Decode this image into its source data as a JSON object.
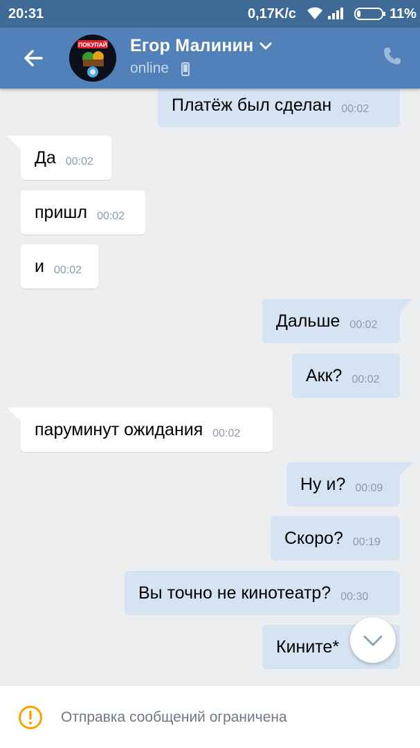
{
  "status_bar": {
    "time": "20:31",
    "speed": "0,17K/c",
    "battery": "11%"
  },
  "header": {
    "name": "Егор Малинин",
    "status": "online",
    "avatar_label": "ПОКУПАЙ"
  },
  "messages": [
    {
      "text": "Платёж был сделан",
      "time": "00:02",
      "dir": "out"
    },
    {
      "text": "Да",
      "time": "00:02",
      "dir": "in"
    },
    {
      "text": "пришл",
      "time": "00:02",
      "dir": "in"
    },
    {
      "text": "и",
      "time": "00:02",
      "dir": "in"
    },
    {
      "text": "Дальше",
      "time": "00:02",
      "dir": "out"
    },
    {
      "text": "Акк?",
      "time": "00:02",
      "dir": "out"
    },
    {
      "text": "паруминут ожидания",
      "time": "00:02",
      "dir": "in"
    },
    {
      "text": "Ну и?",
      "time": "00:09",
      "dir": "out"
    },
    {
      "text": "Скоро?",
      "time": "00:19",
      "dir": "out"
    },
    {
      "text": "Вы точно не кинотеатр?",
      "time": "00:30",
      "dir": "out"
    },
    {
      "text": "Кините*",
      "time": "",
      "dir": "out"
    }
  ],
  "bottom_bar": {
    "notice": "Отправка сообщений ограничена",
    "icon": "warning-icon"
  },
  "colors": {
    "header": "#5181b8",
    "status_bar": "#3f6a96",
    "background": "#edeef0",
    "bubble_out": "#d6e3f2",
    "bubble_in": "#ffffff",
    "warning": "#ffa000"
  }
}
